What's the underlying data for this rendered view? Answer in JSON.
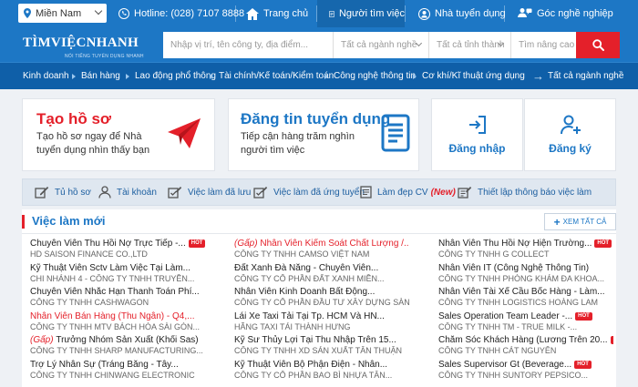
{
  "topbar": {
    "region": "Miền Nam",
    "hotline": "Hotline: (028) 7107 8888",
    "nav": [
      {
        "label": "Trang chủ",
        "icon": "house-icon"
      },
      {
        "label": "Người tìm việc",
        "icon": "job-seeker-icon"
      },
      {
        "label": "Nhà tuyển dụng",
        "icon": "employer-icon"
      },
      {
        "label": "Góc nghề nghiệp",
        "icon": "career-corner-icon"
      }
    ]
  },
  "brand": {
    "logo_text": "TÌMVIỆCNHANH",
    "logo_tagline": "NỔI TIẾNG TUYỂN DỤNG NHANH"
  },
  "search": {
    "keyword_placeholder": "Nhập vị trí, tên công ty, địa điểm...",
    "industry_value": "Tất cả ngành nghề",
    "province_value": "Tất cả tỉnh thành",
    "advanced_label": "Tìm nâng cao"
  },
  "categories": [
    "Kinh doanh",
    "Bán hàng",
    "Lao động phổ thông",
    "Tài chính/Kế toán/Kiểm toán",
    "Công nghệ thông tin",
    "Cơ khí/Kĩ thuật ứng dụng",
    "Tất cả ngành nghề"
  ],
  "promo": {
    "profile": {
      "title": "Tạo hồ sơ",
      "desc": "Tạo hồ sơ ngay để Nhà tuyển dụng nhìn thấy bạn"
    },
    "post": {
      "title": "Đăng tin tuyển dụng",
      "desc": "Tiếp cận hàng trăm nghìn người tìm việc"
    },
    "login_label": "Đăng nhập",
    "register_label": "Đăng ký"
  },
  "quick_links": [
    {
      "label": "Tủ hồ sơ",
      "icon": "edit-icon"
    },
    {
      "label": "Tài khoản",
      "icon": "user-icon"
    },
    {
      "label": "Việc làm đã lưu",
      "icon": "check-edit-icon"
    },
    {
      "label": "Việc làm đã ứng tuyển",
      "icon": "check-edit-icon"
    },
    {
      "label": "Làm đẹp CV",
      "icon": "document-icon",
      "badge": "(New)"
    },
    {
      "label": "Thiết lập thông báo việc làm",
      "icon": "settings-edit-icon"
    }
  ],
  "jobs": {
    "title": "Việc làm mới",
    "view_all": "XEM TẤT CẢ",
    "hot_label": "HOT",
    "columns": [
      [
        {
          "title": "Chuyên Viên Thu Hồi Nợ Trực Tiếp -...",
          "company": "HD SAISON FINANCE CO.,LTD",
          "hot": true
        },
        {
          "title": "Kỹ Thuật Viên Sctv Làm Việc Tại Làm...",
          "company": "CHI NHÁNH 4 - CÔNG TY TNHH TRUYỀN...",
          "hot": false
        },
        {
          "title": "Chuyên Viên Nhắc Hạn Thanh Toán Phí...",
          "company": "CÔNG TY TNHH CASHWAGON",
          "hot": false
        },
        {
          "title": "Nhân Viên Bán Hàng (Thu Ngân) - Q4,...",
          "company": "CÔNG TY TNHH MTV BÁCH HÓA SÀI GÒN...",
          "hot": false,
          "highlight": true
        },
        {
          "title": "Trưởng Nhóm Sản Xuất (Khối Sas)",
          "company": "CÔNG TY TNHH SHARP MANUFACTURING...",
          "hot": false,
          "tag": "(Gấp)"
        },
        {
          "title": "Trợ Lý Nhân Sự (Tráng Băng - Tây...",
          "company": "CÔNG TY TNHH CHINWANG ELECTRONIC",
          "hot": false
        }
      ],
      [
        {
          "title": "Nhân Viên Kiểm Soát Chất Lượng /...",
          "company": "CÔNG TY TNHH CAMSO VIỆT NAM",
          "hot": false,
          "tag": "(Gấp)",
          "highlight": true
        },
        {
          "title": "Đất Xanh Đà Nẵng - Chuyên Viên...",
          "company": "CÔNG TY CỔ PHẦN ĐẤT XANH MIỀN...",
          "hot": false
        },
        {
          "title": "Nhân Viên Kinh Doanh Bất Động...",
          "company": "CÔNG TY CỔ PHẦN ĐẦU TƯ XÂY DỰNG SÀN...",
          "hot": false
        },
        {
          "title": "Lái Xe Taxi Tải Tại Tp. HCM Và HN...",
          "company": "HÃNG TAXI TẢI THÀNH HƯNG",
          "hot": false
        },
        {
          "title": "Kỹ Sư Thủy Lợi Tại Thu Nhập Trên 15...",
          "company": "CÔNG TY TNHH XD SẢN XUẤT TÂN THUẬN",
          "hot": false
        },
        {
          "title": "Kỹ Thuật Viên Bộ Phận Điện - Nhân...",
          "company": "CÔNG TY CỔ PHẦN BAO BÌ NHỰA TÂN...",
          "hot": false
        }
      ],
      [
        {
          "title": "Nhân Viên Thu Hồi Nợ Hiện Trường...",
          "company": "CÔNG TY TNHH G COLLECT",
          "hot": true
        },
        {
          "title": "Nhân Viên IT (Công Nghệ Thông Tin)",
          "company": "CÔNG TY TNHH PHÒNG KHÁM ĐA KHOA...",
          "hot": false
        },
        {
          "title": "Nhân Viên Tài Xế Cầu Bốc Hàng - Làm...",
          "company": "CÔNG TY TNHH LOGISTICS HOÀNG LAM",
          "hot": false
        },
        {
          "title": "Sales Operation Team Leader -...",
          "company": "CÔNG TY TNHH TM - TRUE MILK -...",
          "hot": true
        },
        {
          "title": "Chăm Sóc Khách Hàng (Lương Trên 20...",
          "company": "CÔNG TY TNHH CÁT NGUYÊN",
          "hot": true
        },
        {
          "title": "Sales Supervisor Gt (Beverage...",
          "company": "CÔNG TY TNHH SUNTORY PEPSICO...",
          "hot": true
        }
      ]
    ]
  },
  "colors": {
    "primary_blue": "#1d77c5",
    "dark_blue": "#0f5fa8",
    "accent_red": "#e4202a"
  }
}
